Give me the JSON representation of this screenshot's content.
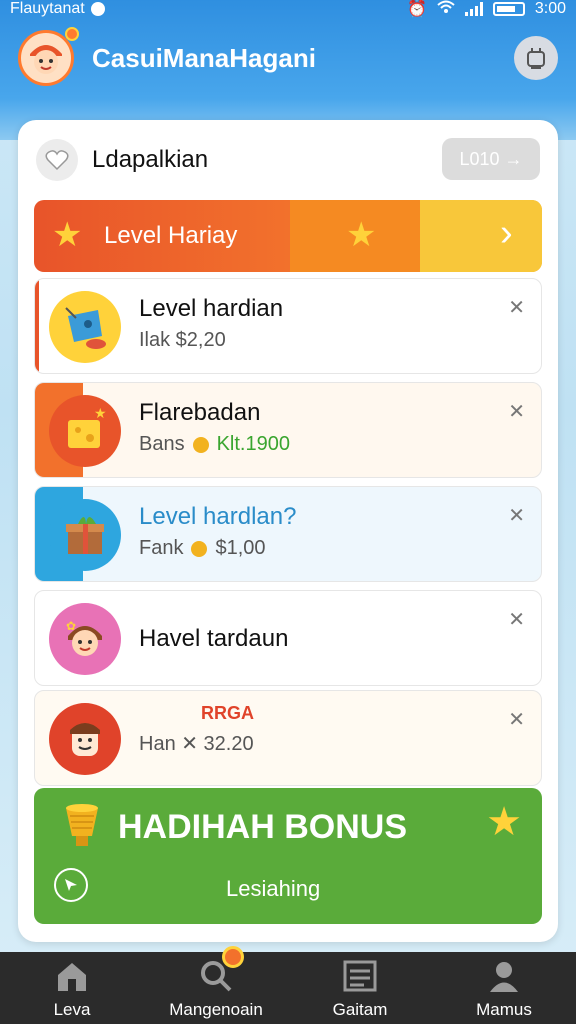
{
  "status_bar": {
    "carrier": "Flauytanat",
    "time": "3:00"
  },
  "app": {
    "title": "CasuiManaHagani"
  },
  "card": {
    "title": "Ldapalkian",
    "login_button": "L010 →"
  },
  "level_banner": {
    "label": "Level Hariay"
  },
  "list_items": [
    {
      "title": "Level hardian",
      "subtitle": "Ilak $2,20",
      "icon": "toy-bucket-icon"
    },
    {
      "title": "Flarebadan",
      "subtitle_prefix": "Bans",
      "subtitle_value": "Klt.1900",
      "icon": "gift-cheese-icon"
    },
    {
      "title": "Level hardlan?",
      "subtitle_prefix": "Fank",
      "subtitle_value": "$1,00",
      "icon": "present-box-icon"
    },
    {
      "title": "Havel tardaun",
      "icon": "girl-avatar-icon"
    },
    {
      "badge": "RRGA",
      "subtitle": "Han  ✕  32.20",
      "icon": "boy-avatar-icon"
    }
  ],
  "bonus": {
    "title": "HADIHAH BONUS",
    "subtitle": "Lesiahing"
  },
  "nav": [
    {
      "label": "Leva",
      "icon": "home-icon"
    },
    {
      "label": "Mangenoain",
      "icon": "search-icon"
    },
    {
      "label": "Gaitam",
      "icon": "grid-icon"
    },
    {
      "label": "Mamus",
      "icon": "profile-icon"
    }
  ],
  "colors": {
    "header_blue": "#2f8fe0",
    "banner_red": "#e8542a",
    "banner_orange": "#f58a22",
    "banner_yellow": "#f8c73a",
    "bonus_green": "#5aab3a",
    "nav_dark": "#2b2b2b",
    "accent_green_text": "#3aa52f",
    "accent_blue_text": "#2a8cc9"
  }
}
